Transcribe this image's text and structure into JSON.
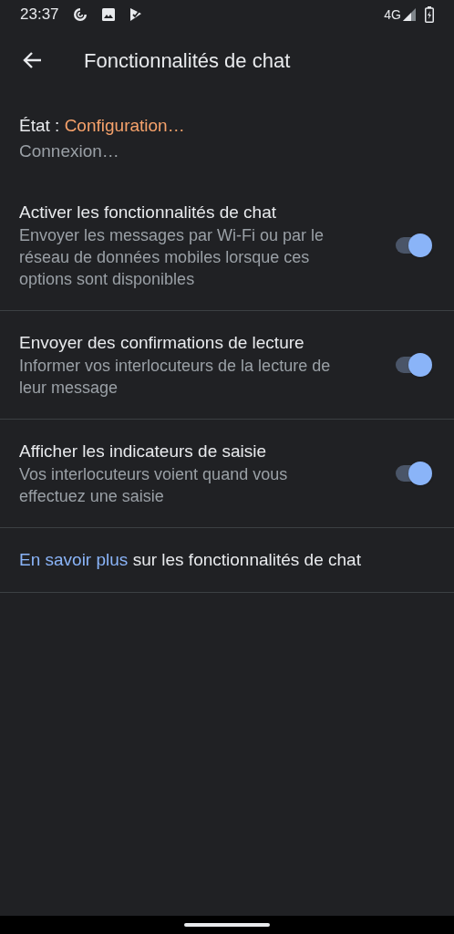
{
  "status_bar": {
    "time": "23:37",
    "network": "4G"
  },
  "toolbar": {
    "title": "Fonctionnalités de chat"
  },
  "status": {
    "label": "État :",
    "value": "Configuration…",
    "detail": "Connexion…"
  },
  "settings": [
    {
      "title": "Activer les fonctionnalités de chat",
      "summary": "Envoyer les messages par Wi-Fi ou par le réseau de données mobiles lorsque ces options sont disponibles",
      "on": true
    },
    {
      "title": "Envoyer des confirmations de lecture",
      "summary": "Informer vos interlocuteurs de la lecture de leur message",
      "on": true
    },
    {
      "title": "Afficher les indicateurs de saisie",
      "summary": "Vos interlocuteurs voient quand vous effectuez une saisie",
      "on": true
    }
  ],
  "learn_more": {
    "link": "En savoir plus",
    "text": "sur les fonctionnalités de chat"
  }
}
